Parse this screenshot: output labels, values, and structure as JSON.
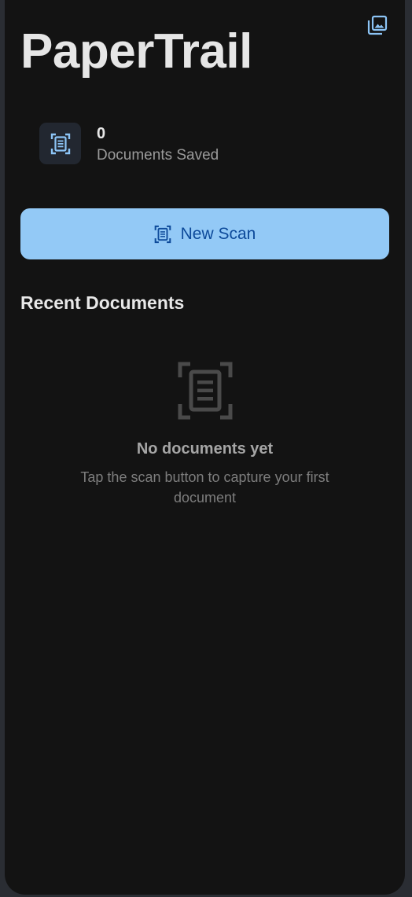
{
  "app": {
    "title": "PaperTrail"
  },
  "header": {
    "gallery_icon": "photo-library-icon"
  },
  "stats": {
    "count": "0",
    "label": "Documents Saved",
    "icon": "document-scanner-icon"
  },
  "scan_button": {
    "label": "New Scan",
    "icon": "document-scanner-icon"
  },
  "recent": {
    "title": "Recent Documents"
  },
  "empty_state": {
    "icon": "document-scanner-icon",
    "title": "No documents yet",
    "subtitle": "Tap the scan button to capture your first document"
  },
  "colors": {
    "background": "#131313",
    "accent": "#93c9f6",
    "accent_text": "#0d4a9a",
    "icon_accent": "#8cc4f5"
  }
}
